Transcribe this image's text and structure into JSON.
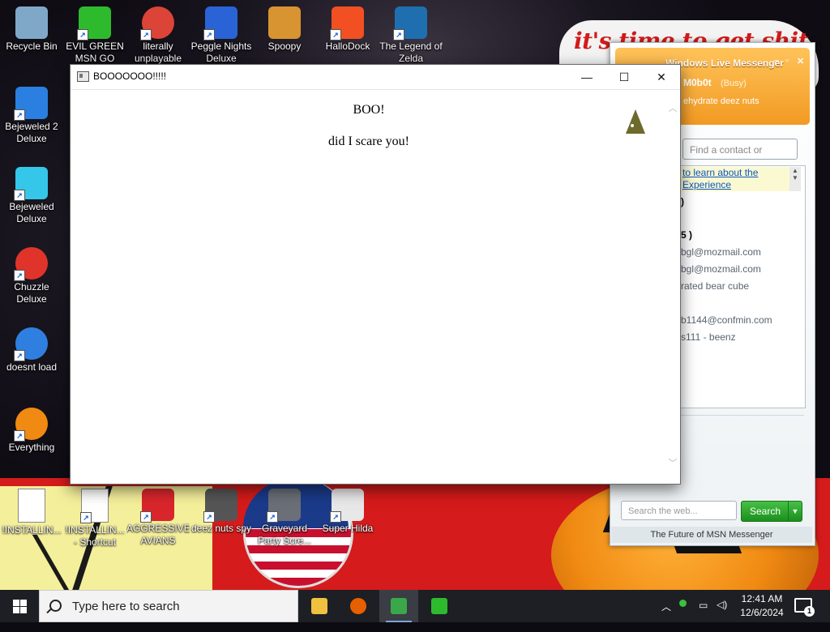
{
  "wallpaper": {
    "slogan": "it's time to get shit"
  },
  "desktop_icons": [
    {
      "label": "Recycle Bin",
      "icon": "recycle-bin-icon",
      "color": "#7fa8c8",
      "shortcut": false
    },
    {
      "label": "EVIL GREEN MSN GO",
      "icon": "msn-buddy-icon",
      "color": "#2dbb2d",
      "shortcut": true
    },
    {
      "label": "literally unplayable",
      "icon": "chrome-icon",
      "color": "#db4437",
      "shortcut": true
    },
    {
      "label": "Peggle Nights Deluxe",
      "icon": "peggle-icon",
      "color": "#2a63d6",
      "shortcut": true
    },
    {
      "label": "Spoopy",
      "icon": "door-icon",
      "color": "#d89430",
      "shortcut": false
    },
    {
      "label": "HalloDock",
      "icon": "windows-logo-icon",
      "color": "#f25022",
      "shortcut": true
    },
    {
      "label": "The Legend of Zelda",
      "icon": "pixel-hero-icon",
      "color": "#1f6fb0",
      "shortcut": true
    },
    {
      "label": "Bejeweled 2 Deluxe",
      "icon": "bejeweled2-icon",
      "color": "#2a7fe0",
      "shortcut": true
    },
    {
      "label": "Bejeweled Deluxe",
      "icon": "diamond-icon",
      "color": "#35c7ea",
      "shortcut": true
    },
    {
      "label": "Chuzzle Deluxe",
      "icon": "chuzzle-icon",
      "color": "#e0342a",
      "shortcut": true
    },
    {
      "label": "doesnt load",
      "icon": "thunderbird-icon",
      "color": "#2f7fe0",
      "shortcut": true
    },
    {
      "label": "Everything",
      "icon": "everything-search-icon",
      "color": "#f08a12",
      "shortcut": true
    },
    {
      "label": "!INSTALLIN...",
      "icon": "text-file-icon",
      "color": "#ffffff",
      "shortcut": false
    },
    {
      "label": "!INSTALLIN... - Shortcut",
      "icon": "text-file-icon",
      "color": "#ffffff",
      "shortcut": true
    },
    {
      "label": "AGGRESSIVE AVIANS",
      "icon": "angry-bird-icon",
      "color": "#d9262c",
      "shortcut": true
    },
    {
      "label": "deez nuts spy",
      "icon": "stacked-windows-icon",
      "color": "#555555",
      "shortcut": true
    },
    {
      "label": "Graveyard Party Scre...",
      "icon": "tombstone-icon",
      "color": "#6b6f78",
      "shortcut": true
    },
    {
      "label": "Super Hilda",
      "icon": "pixel-character-icon",
      "color": "#e8e8e8",
      "shortcut": true
    }
  ],
  "msn": {
    "title": "Windows Live Messenger",
    "user_name": "M0b0t",
    "status": "(Busy)",
    "personal_message": "ehydrate deez nuts",
    "find_placeholder": "Find a contact or number",
    "banner_line1": "to learn about the",
    "banner_line2": "Experience",
    "contacts": [
      {
        "text": ")",
        "bold": true
      },
      {
        "text": "5 )",
        "bold": true
      },
      {
        "text": "bgl@mozmail.com",
        "bold": false
      },
      {
        "text": "bgl@mozmail.com",
        "bold": false
      },
      {
        "text": "rated bear cube",
        "bold": false
      },
      {
        "text": "b1144@confmin.com",
        "bold": false
      },
      {
        "text": "s111 - beenz",
        "bold": false
      }
    ],
    "search_placeholder": "Search the web...",
    "search_button": "Search",
    "footer": "The Future of MSN Messenger",
    "accent_color": "#f29a23"
  },
  "window": {
    "title": "BOOOOOOO!!!!!",
    "minimize": "—",
    "maximize": "☐",
    "close": "✕",
    "heading": "BOO!",
    "message": "did I scare you!"
  },
  "taskbar": {
    "search_placeholder": "Type here to search",
    "apps": [
      {
        "name": "file-explorer-icon",
        "active": false
      },
      {
        "name": "firefox-icon",
        "active": false
      },
      {
        "name": "window-app-icon",
        "active": true
      },
      {
        "name": "msn-buddy-icon",
        "active": false
      }
    ],
    "time": "12:41 AM",
    "date": "12/6/2024",
    "notification_count": "1"
  }
}
